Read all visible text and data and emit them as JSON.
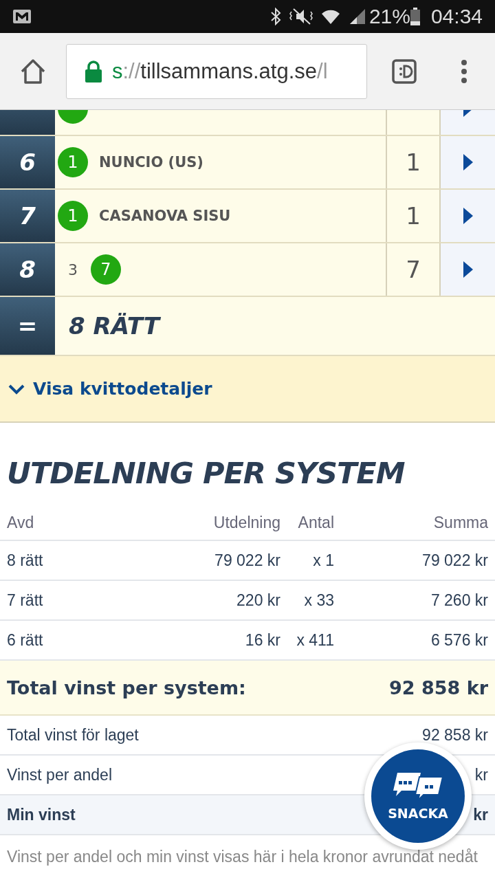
{
  "status_bar": {
    "battery": "21%",
    "time": "04:34"
  },
  "browser": {
    "url_scheme": "s",
    "url_separator": "://",
    "url_host": "tillsammans.atg.se",
    "url_path": "/l"
  },
  "legs": [
    {
      "picks": [
        {
          "winner": true
        }
      ]
    },
    {
      "number": "6",
      "picks": [
        {
          "text": "1",
          "winner": true
        }
      ],
      "horse": "NUNCIO (US)",
      "result": "1"
    },
    {
      "number": "7",
      "picks": [
        {
          "text": "1",
          "winner": true
        }
      ],
      "horse": "CASANOVA SISU",
      "result": "1"
    },
    {
      "number": "8",
      "picks": [
        {
          "text": "3",
          "winner": false
        },
        {
          "text": "7",
          "winner": true
        }
      ],
      "result": "7"
    }
  ],
  "total_row": {
    "symbol": "=",
    "text": "8 RÄTT"
  },
  "details_toggle": {
    "label": "Visa kvittodetaljer",
    "expanded": false
  },
  "payout": {
    "title": "UTDELNING PER SYSTEM",
    "columns": [
      "Avd",
      "Utdelning",
      "Antal",
      "Summa"
    ],
    "rows": [
      [
        "8 rätt",
        "79 022 kr",
        "x 1",
        "79 022 kr"
      ],
      [
        "7 rätt",
        "220 kr",
        "x 33",
        "7 260 kr"
      ],
      [
        "6 rätt",
        "16 kr",
        "x 411",
        "6 576 kr"
      ]
    ],
    "total": {
      "label": "Total vinst per system:",
      "value": "92 858 kr"
    },
    "summary": [
      {
        "label": "Total vinst för laget",
        "value": "92 858 kr",
        "bold": false
      },
      {
        "label": "Vinst per andel",
        "value": "kr",
        "bold": false
      },
      {
        "label": "Min vinst",
        "value": "kr",
        "bold": true
      }
    ],
    "note": "Vinst per andel och min vinst visas här i hela kronor avrundat nedåt"
  },
  "chat_button": {
    "label": "SNACKA"
  }
}
